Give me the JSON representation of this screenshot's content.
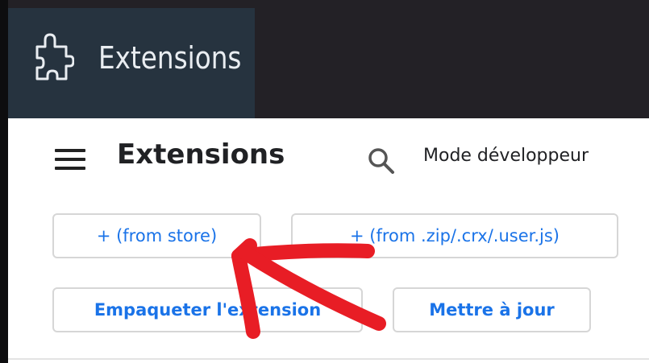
{
  "app": {
    "title": "Extensions"
  },
  "header": {
    "title": "Extensions",
    "developer_mode_label": "Mode développeur"
  },
  "buttons": {
    "from_store": "+ (from store)",
    "from_file": "+ (from .zip/.crx/.user.js)",
    "pack_extension": "Empaqueter l'extension",
    "update": "Mettre à jour"
  },
  "icons": {
    "app": "puzzle-icon",
    "menu": "hamburger-menu-icon",
    "search": "search-icon"
  },
  "colors": {
    "top_tile_bg": "#26333f",
    "button_text": "#1a73e8",
    "annotation_arrow": "#e81d25"
  }
}
